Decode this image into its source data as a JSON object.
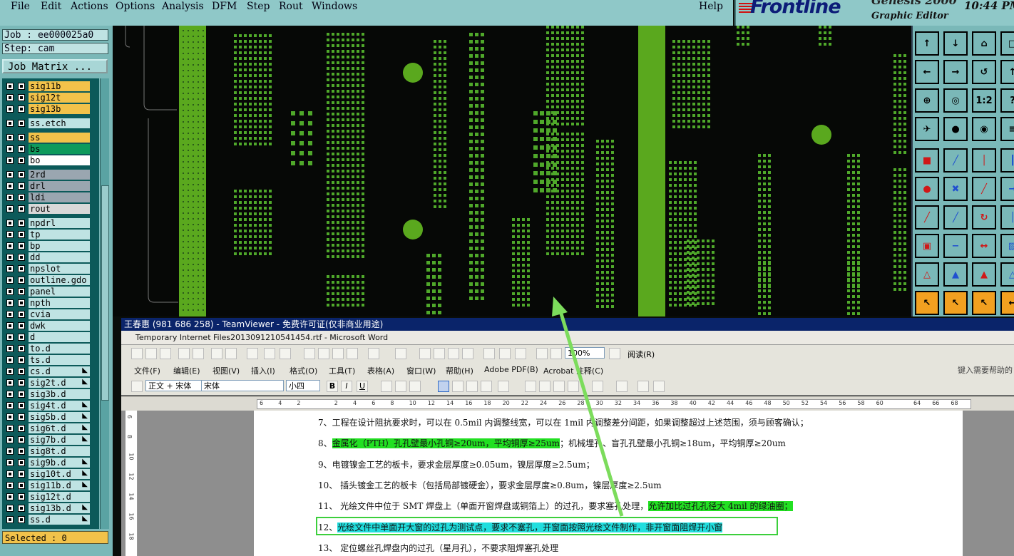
{
  "menubar": {
    "items": [
      "File",
      "Edit",
      "Actions",
      "Options",
      "Analysis",
      "DFM",
      "Step",
      "Rout",
      "Windows"
    ],
    "help": "Help"
  },
  "branding": {
    "company": "Frontline",
    "product": "Genesis 2000",
    "subtitle": "Graphic Editor",
    "clock": "10:44 PM"
  },
  "job": {
    "job_label": "Job : ee000025a0",
    "step_label": "Step: cam",
    "matrix_button": "Job Matrix ..."
  },
  "layers": [
    {
      "name": "sig11b",
      "color": "#f2c24a",
      "arrow": false
    },
    {
      "name": "sig12t",
      "color": "#f2c24a",
      "arrow": false
    },
    {
      "name": "sig13b",
      "color": "#f2c24a",
      "arrow": false
    },
    {
      "name": "ss.etch",
      "color": "#bfe3e3",
      "arrow": false
    },
    {
      "name": "ss",
      "color": "#f2c24a",
      "arrow": false
    },
    {
      "name": "bs",
      "color": "#0e9a5c",
      "arrow": false
    },
    {
      "name": "bo",
      "color": "#ffffff",
      "arrow": false
    },
    {
      "name": "2rd",
      "color": "#9aa6b0",
      "arrow": false
    },
    {
      "name": "drl",
      "color": "#9aa6b0",
      "arrow": false
    },
    {
      "name": "ldi",
      "color": "#9aa6b0",
      "arrow": false
    },
    {
      "name": "rout",
      "color": "#d8d8d8",
      "arrow": false
    },
    {
      "name": "npdrl",
      "color": "#bfe3e3",
      "arrow": false
    },
    {
      "name": "tp",
      "color": "#bfe3e3",
      "arrow": false
    },
    {
      "name": "bp",
      "color": "#bfe3e3",
      "arrow": false
    },
    {
      "name": "dd",
      "color": "#bfe3e3",
      "arrow": false
    },
    {
      "name": "npslot",
      "color": "#bfe3e3",
      "arrow": false
    },
    {
      "name": "outline.gdo",
      "color": "#bfe3e3",
      "arrow": false
    },
    {
      "name": "panel",
      "color": "#bfe3e3",
      "arrow": false
    },
    {
      "name": "npth",
      "color": "#bfe3e3",
      "arrow": false
    },
    {
      "name": "cvia",
      "color": "#bfe3e3",
      "arrow": false
    },
    {
      "name": "dwk",
      "color": "#bfe3e3",
      "arrow": false
    },
    {
      "name": "d",
      "color": "#bfe3e3",
      "arrow": false
    },
    {
      "name": "to.d",
      "color": "#bfe3e3",
      "arrow": false
    },
    {
      "name": "ts.d",
      "color": "#bfe3e3",
      "arrow": false
    },
    {
      "name": "cs.d",
      "color": "#bfe3e3",
      "arrow": true
    },
    {
      "name": "sig2t.d",
      "color": "#bfe3e3",
      "arrow": true
    },
    {
      "name": "sig3b.d",
      "color": "#bfe3e3",
      "arrow": false
    },
    {
      "name": "sig4t.d",
      "color": "#bfe3e3",
      "arrow": true
    },
    {
      "name": "sig5b.d",
      "color": "#bfe3e3",
      "arrow": true
    },
    {
      "name": "sig6t.d",
      "color": "#bfe3e3",
      "arrow": true
    },
    {
      "name": "sig7b.d",
      "color": "#bfe3e3",
      "arrow": true
    },
    {
      "name": "sig8t.d",
      "color": "#bfe3e3",
      "arrow": false
    },
    {
      "name": "sig9b.d",
      "color": "#bfe3e3",
      "arrow": true
    },
    {
      "name": "sig10t.d",
      "color": "#bfe3e3",
      "arrow": true
    },
    {
      "name": "sig11b.d",
      "color": "#bfe3e3",
      "arrow": true
    },
    {
      "name": "sig12t.d",
      "color": "#bfe3e3",
      "arrow": false
    },
    {
      "name": "sig13b.d",
      "color": "#bfe3e3",
      "arrow": true
    },
    {
      "name": "ss.d",
      "color": "#bfe3e3",
      "arrow": true
    }
  ],
  "selected_label": "Selected : 0",
  "teamviewer": {
    "title": "王春惠 (981 686 258) - TeamViewer - 免费许可证(仅非商业用途)"
  },
  "word": {
    "title": "Temporary Internet Files2013091210541454.rtf - Microsoft Word",
    "menus": [
      "文件(F)",
      "编辑(E)",
      "视图(V)",
      "插入(I)",
      "格式(O)",
      "工具(T)",
      "表格(A)",
      "窗口(W)",
      "帮助(H)",
      "Adobe PDF(B)",
      "Acrobat 注释(C)"
    ],
    "help_hint": "键入需要帮助的",
    "zoom": "100%",
    "read_label": "阅读(R)",
    "style": "正文 + 宋体",
    "font": "宋体",
    "size": "小四",
    "ruler_ticks": [
      "6",
      "4",
      "2",
      "",
      "2",
      "4",
      "6",
      "8",
      "10",
      "12",
      "14",
      "16",
      "18",
      "20",
      "22",
      "24",
      "26",
      "28",
      "30",
      "32",
      "34",
      "36",
      "38",
      "40",
      "42",
      "44",
      "46",
      "48",
      "50",
      "52",
      "54",
      "56",
      "58",
      "60",
      "",
      "64",
      "66",
      "68"
    ],
    "vruler_ticks": [
      "6",
      "8",
      "10",
      "12",
      "14",
      "16",
      "18"
    ]
  },
  "doc_lines": {
    "l7": "7、工程在设计阻抗要求时，可以在 0.5mil 内调整线宽，可以在 1mil 内调整差分间距，如果调整超过上述范围，须与顾客确认；",
    "l8_num": "8、",
    "l8_hl": "金属化（PTH）孔孔壁最小孔铜≥20um，平均铜厚≥25um",
    "l8_rest": "；机械埋孔、盲孔孔壁最小孔铜≥18um，平均铜厚≥20um",
    "l9": "9、电镀镍金工艺的板卡，要求金层厚度≥0.05um，镍层厚度≥2.5um；",
    "l10": "10、 插头镀金工艺的板卡（包括局部镀硬金），要求金层厚度≥0.8um，镍层厚度≥2.5um",
    "l11_pre": "11、 光绘文件中位于 SMT 焊盘上（单面开窗焊盘或铜箔上）的过孔，要求塞孔处理，",
    "l11_hl": "允许加比过孔孔径大 4mil 的绿油圈；",
    "l12_num": "12、",
    "l12_hl": "光绘文件中单面开大窗的过孔为测试点，要求不塞孔，开窗面按照光绘文件制作，非开窗面阻焊开小窗",
    "l13": "13、 定位螺丝孔焊盘内的过孔（星月孔），不要求阻焊塞孔处理"
  },
  "toolbox": {
    "labels": [
      "1:2",
      "?"
    ]
  },
  "colors": {
    "menubar_bg": "#8fc8c8",
    "pcb_green": "#5aa81e",
    "via_green": "#4fa82a",
    "highlight_green": "#22e022",
    "highlight_cyan": "#21dede"
  }
}
